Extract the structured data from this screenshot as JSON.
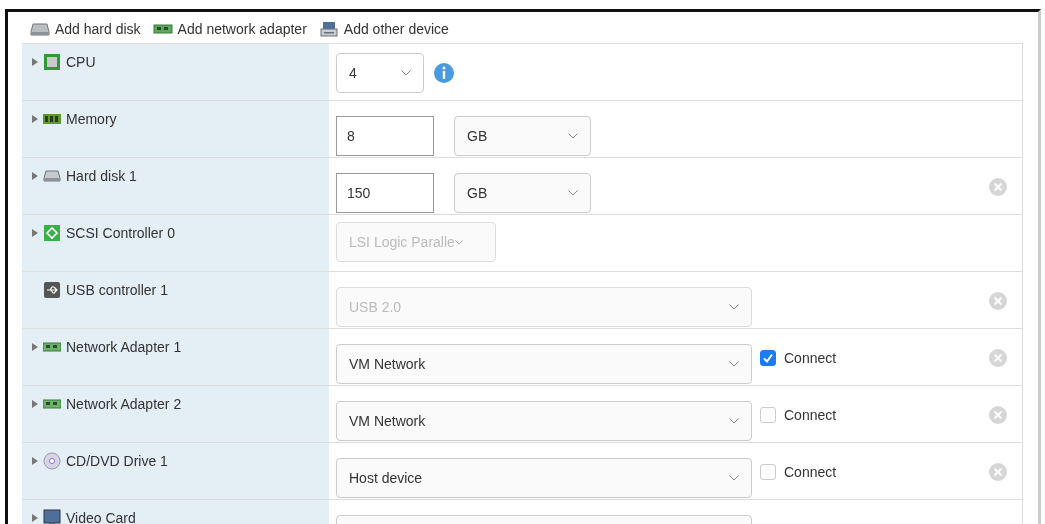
{
  "toolbar": [
    {
      "label": "Add hard disk",
      "kind": "disk"
    },
    {
      "label": "Add network adapter",
      "kind": "nic"
    },
    {
      "label": "Add other device",
      "kind": "device"
    }
  ],
  "rows": [
    {
      "label": "CPU",
      "kind": "cpu",
      "expandable": true,
      "removable": false,
      "select": {
        "value": "4",
        "disabled": false
      },
      "info": true
    },
    {
      "label": "Memory",
      "kind": "memory",
      "expandable": true,
      "removable": false,
      "input": {
        "value": "8"
      },
      "select": {
        "value": "GB",
        "disabled": false
      }
    },
    {
      "label": "Hard disk 1",
      "kind": "disk",
      "expandable": true,
      "removable": true,
      "input": {
        "value": "150"
      },
      "select": {
        "value": "GB",
        "disabled": false
      }
    },
    {
      "label": "SCSI Controller 0",
      "kind": "scsi",
      "expandable": true,
      "removable": false,
      "select": {
        "value": "LSI Logic Paralle",
        "disabled": true
      }
    },
    {
      "label": "USB controller 1",
      "kind": "usb",
      "expandable": false,
      "removable": true,
      "select": {
        "value": "USB 2.0",
        "disabled": true
      }
    },
    {
      "label": "Network Adapter 1",
      "kind": "nic",
      "expandable": true,
      "removable": true,
      "select": {
        "value": "VM Network",
        "disabled": false
      },
      "connect": {
        "label": "Connect",
        "checked": true
      }
    },
    {
      "label": "Network Adapter 2",
      "kind": "nic",
      "expandable": true,
      "removable": true,
      "select": {
        "value": "VM Network",
        "disabled": false
      },
      "connect": {
        "label": "Connect",
        "checked": false
      }
    },
    {
      "label": "CD/DVD Drive 1",
      "kind": "cd",
      "expandable": true,
      "removable": true,
      "select": {
        "value": "Host device",
        "disabled": false
      },
      "connect": {
        "label": "Connect",
        "checked": false
      }
    },
    {
      "label": "Video Card",
      "kind": "monitor",
      "expandable": true,
      "removable": false,
      "select": {
        "disabled": false
      }
    }
  ]
}
